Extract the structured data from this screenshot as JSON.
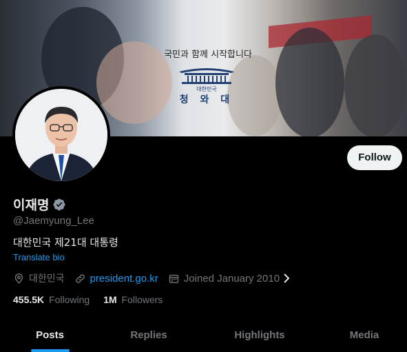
{
  "banner": {
    "slogan": "국민과 함께 시작합니다",
    "subtitle": "대한민국",
    "name": "청 와 대"
  },
  "profile": {
    "name": "이재명",
    "handle": "@Jaemyung_Lee",
    "bio": "대한민국 제21대 대통령",
    "translate_label": "Translate bio",
    "location": "대한민국",
    "website": "president.go.kr",
    "joined": "Joined January 2010",
    "following_count": "455.5K",
    "following_label": "Following",
    "followers_count": "1M",
    "followers_label": "Followers"
  },
  "actions": {
    "follow_label": "Follow"
  },
  "tabs": [
    {
      "label": "Posts",
      "active": true
    },
    {
      "label": "Replies",
      "active": false
    },
    {
      "label": "Highlights",
      "active": false
    },
    {
      "label": "Media",
      "active": false
    }
  ],
  "colors": {
    "accent": "#1d9bf0",
    "background": "#000000",
    "secondary_text": "#71767b"
  },
  "icons": [
    "verified-badge-icon",
    "location-icon",
    "link-icon",
    "calendar-icon",
    "chevron-right-icon"
  ]
}
